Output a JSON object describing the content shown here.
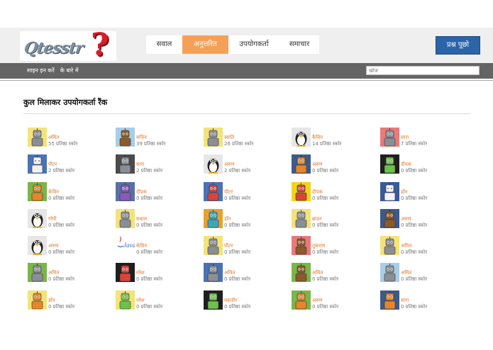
{
  "header": {
    "logo_text": "Qtesstr",
    "nav": [
      {
        "label": "सवाल",
        "active": false
      },
      {
        "label": "अनुत्तरित",
        "active": true
      },
      {
        "label": "उपयोगकर्ता",
        "active": false
      },
      {
        "label": "समाचार",
        "active": false
      }
    ],
    "ask_button": "प्रश्न पूछो"
  },
  "subbar": {
    "links": [
      "साइन इन करें",
      "के बारे में"
    ],
    "search_placeholder": "खोज"
  },
  "page": {
    "title": "कुल मिलाकर उपयोगकर्ता रैंक",
    "score_suffix": "प्रतिष्ठा स्कोर"
  },
  "colors": {
    "accent": "#f6a057",
    "ask_button": "#2b64a8",
    "subbar": "#646464",
    "username": "#e07a2a"
  },
  "users": [
    {
      "name": "अमित",
      "score": "55",
      "avatar": "robot-gray-icon",
      "bg": "#f2e37a"
    },
    {
      "name": "सचिन",
      "score": "39",
      "avatar": "robot-brown-icon",
      "bg": "#a8cde6"
    },
    {
      "name": "स्वाति",
      "score": "26",
      "avatar": "robot-gray-icon",
      "bg": "#f2e37a"
    },
    {
      "name": "कैविन",
      "score": "14",
      "avatar": "penguin-icon",
      "bg": "#e6e6e6"
    },
    {
      "name": "सारा",
      "score": "7",
      "avatar": "robot-gray-icon",
      "bg": "#e97a7a"
    },
    {
      "name": "पीटर",
      "score": "2",
      "avatar": "robot-white-icon",
      "bg": "#4a73b5"
    },
    {
      "name": "सारा",
      "score": "2",
      "avatar": "robot-gray-icon",
      "bg": "#4b4b4b"
    },
    {
      "name": "अरुण",
      "score": "2",
      "avatar": "penguin-icon",
      "bg": "#e6e6e6"
    },
    {
      "name": "अरुण",
      "score": "0",
      "avatar": "robot-orange-icon",
      "bg": "#3c5a8a"
    },
    {
      "name": "दीपक",
      "score": "0",
      "avatar": "robot-green-icon",
      "bg": "#1f1f1f"
    },
    {
      "name": "केविन",
      "score": "0",
      "avatar": "robot-orange-icon",
      "bg": "#7ab648"
    },
    {
      "name": "दीपक",
      "score": "0",
      "avatar": "robot-purple-icon",
      "bg": "#5a6fa8"
    },
    {
      "name": "पीटर",
      "score": "0",
      "avatar": "robot-red-icon",
      "bg": "#4a73b5"
    },
    {
      "name": "दीपक",
      "score": "0",
      "avatar": "robot-red-icon",
      "bg": "#f0d51d"
    },
    {
      "name": "डॉन",
      "score": "0",
      "avatar": "robot-white-icon",
      "bg": "#3a5a9a"
    },
    {
      "name": "गोपी",
      "score": "0",
      "avatar": "penguin-icon",
      "bg": "#e6e6e6"
    },
    {
      "name": "सवाल",
      "score": "0",
      "avatar": "robot-gray-icon",
      "bg": "#f2e37a"
    },
    {
      "name": "डॉन",
      "score": "0",
      "avatar": "robot-teal-icon",
      "bg": "#e8a030"
    },
    {
      "name": "ब्राउन",
      "score": "0",
      "avatar": "robot-gray-icon",
      "bg": "#f2e37a"
    },
    {
      "name": "अरुण",
      "score": "0",
      "avatar": "robot-brown-icon",
      "bg": "#3c5a8a"
    },
    {
      "name": "अरुण",
      "score": "0",
      "avatar": "penguin-icon",
      "bg": "#e6e6e6"
    },
    {
      "name": "केविन",
      "score": "0",
      "avatar": "java-logo-icon",
      "bg": "#ffffff"
    },
    {
      "name": "पीटर",
      "score": "0",
      "avatar": "robot-gray-icon",
      "bg": "#f2e37a"
    },
    {
      "name": "तुकराम",
      "score": "0",
      "avatar": "robot-brown-icon",
      "bg": "#e97a7a"
    },
    {
      "name": "अमित",
      "score": "0",
      "avatar": "robot-gray-icon",
      "bg": "#f2e37a"
    },
    {
      "name": "अमित",
      "score": "0",
      "avatar": "robot-gray-icon",
      "bg": "#7ab648"
    },
    {
      "name": "रमेश",
      "score": "0",
      "avatar": "robot-red-icon",
      "bg": "#1f1f1f"
    },
    {
      "name": "अमित",
      "score": "0",
      "avatar": "robot-gray-icon",
      "bg": "#4a73b5"
    },
    {
      "name": "अमित",
      "score": "0",
      "avatar": "robot-brown-icon",
      "bg": "#7ab648"
    },
    {
      "name": "अमित",
      "score": "0",
      "avatar": "robot-gray-icon",
      "bg": "#a8cde6"
    },
    {
      "name": "डॉन",
      "score": "0",
      "avatar": "robot-orange-icon",
      "bg": "#f2e37a"
    },
    {
      "name": "रमेश",
      "score": "0",
      "avatar": "robot-green-icon",
      "bg": "#f2e37a"
    },
    {
      "name": "महावीर",
      "score": "0",
      "avatar": "robot-green-icon",
      "bg": "#1f1f1f"
    },
    {
      "name": "अरुण",
      "score": "0",
      "avatar": "robot-orange-icon",
      "bg": "#7ab648"
    },
    {
      "name": "सारा",
      "score": "0",
      "avatar": "robot-orange-icon",
      "bg": "#3c5a8a"
    }
  ]
}
